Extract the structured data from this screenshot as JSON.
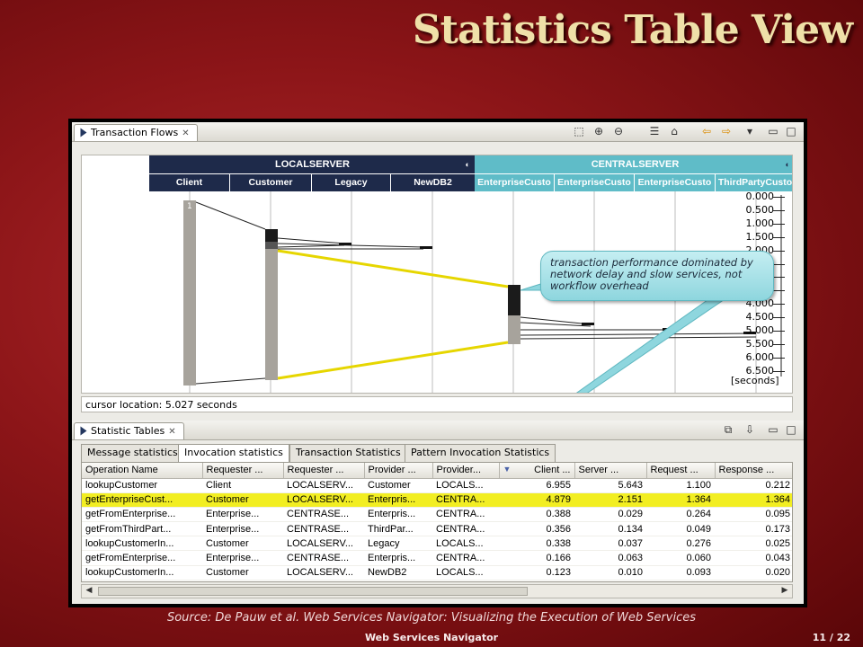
{
  "slide": {
    "title": "Statistics Table View",
    "source": "Source: De Pauw et al. Web Services Navigator: Visualizing the Execution of Web Services",
    "footer_title": "Web Services Navigator",
    "page": "11 / 22"
  },
  "transaction_flows": {
    "view_title": "Transaction Flows",
    "toolbar_icons": [
      "select-icon",
      "zoom-in-icon",
      "zoom-out-icon",
      "list-icon",
      "home-icon",
      "back-arrow-icon",
      "forward-arrow-icon",
      "menu-down-icon",
      "minimize-icon",
      "maximize-icon"
    ],
    "servers": [
      {
        "name": "LOCALSERVER",
        "lanes": [
          "Client",
          "Customer",
          "Legacy",
          "NewDB2"
        ]
      },
      {
        "name": "CENTRALSERVER",
        "lanes": [
          "EnterpriseCusto",
          "EnterpriseCusto",
          "EnterpriseCusto",
          "ThirdPartyCusto"
        ]
      }
    ],
    "time_ticks": [
      "0.000",
      "0.500",
      "1.000",
      "1.500",
      "2.000",
      "2.500",
      "3.000",
      "3.500",
      "4.000",
      "4.500",
      "5.000",
      "5.500",
      "6.000",
      "6.500"
    ],
    "time_unit": "[seconds]",
    "transaction_marker": "1",
    "callout": "transaction performance dominated by network delay and slow services, not workflow overhead",
    "cursor_location": "cursor location: 5.027 seconds",
    "colors": {
      "local": "#1e2a4a",
      "central": "#5fbcc8",
      "highlight": "#f2ee22"
    }
  },
  "statistic_tables": {
    "view_title": "Statistic Tables",
    "tabs": [
      "Message statistics",
      "Invocation statistics",
      "Transaction Statistics",
      "Pattern Invocation Statistics"
    ],
    "active_tab": "Invocation statistics",
    "columns": [
      "Operation Name",
      "Requester ...",
      "Requester ...",
      "Provider ...",
      "Provider...",
      "Client ...",
      "Server ...",
      "Request ...",
      "Response ..."
    ],
    "sort_column": "Client ...",
    "rows": [
      [
        "lookupCustomer",
        "Client",
        "LOCALSERV...",
        "Customer",
        "LOCALS...",
        "6.955",
        "5.643",
        "1.100",
        "0.212"
      ],
      [
        "getEnterpriseCust...",
        "Customer",
        "LOCALSERV...",
        "Enterpris...",
        "CENTRA...",
        "4.879",
        "2.151",
        "1.364",
        "1.364"
      ],
      [
        "getFromEnterprise...",
        "Enterprise...",
        "CENTRASE...",
        "Enterpris...",
        "CENTRA...",
        "0.388",
        "0.029",
        "0.264",
        "0.095"
      ],
      [
        "getFromThirdPart...",
        "Enterprise...",
        "CENTRASE...",
        "ThirdPar...",
        "CENTRA...",
        "0.356",
        "0.134",
        "0.049",
        "0.173"
      ],
      [
        "lookupCustomerIn...",
        "Customer",
        "LOCALSERV...",
        "Legacy",
        "LOCALS...",
        "0.338",
        "0.037",
        "0.276",
        "0.025"
      ],
      [
        "getFromEnterprise...",
        "Enterprise...",
        "CENTRASE...",
        "Enterpris...",
        "CENTRA...",
        "0.166",
        "0.063",
        "0.060",
        "0.043"
      ],
      [
        "lookupCustomerIn...",
        "Customer",
        "LOCALSERV...",
        "NewDB2",
        "LOCALS...",
        "0.123",
        "0.010",
        "0.093",
        "0.020"
      ]
    ],
    "highlighted_row": 1
  }
}
